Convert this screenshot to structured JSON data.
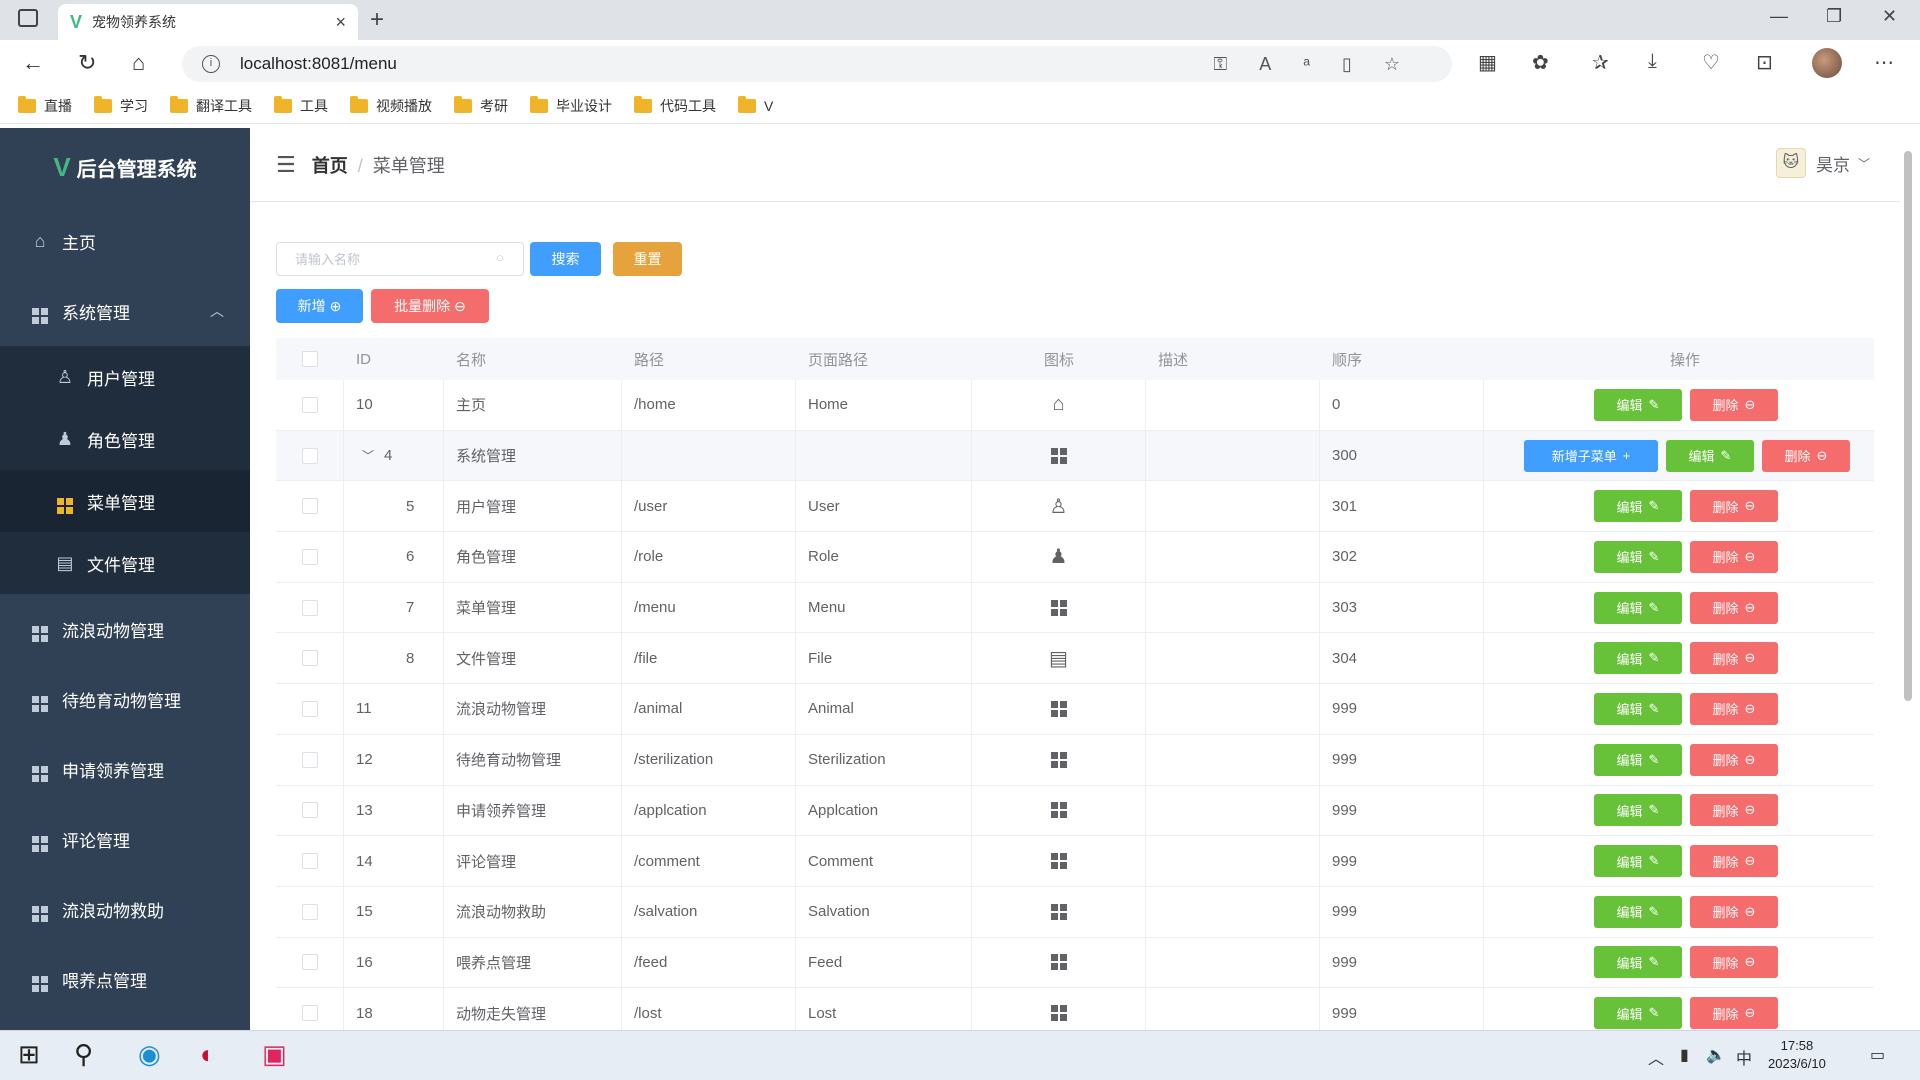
{
  "browser": {
    "tab_title": "宠物领养系统",
    "url": "localhost:8081/menu",
    "bookmarks": [
      "直播",
      "学习",
      "翻译工具",
      "工具",
      "视频播放",
      "考研",
      "毕业设计",
      "代码工具",
      "V"
    ]
  },
  "sidebar": {
    "logo": "后台管理系统",
    "items": [
      {
        "label": "主页",
        "icon": "home-icon"
      },
      {
        "label": "系统管理",
        "icon": "grid-icon"
      },
      {
        "label": "用户管理",
        "icon": "user-icon"
      },
      {
        "label": "角色管理",
        "icon": "user-filled-icon"
      },
      {
        "label": "菜单管理",
        "icon": "grid-icon"
      },
      {
        "label": "文件管理",
        "icon": "document-icon"
      },
      {
        "label": "流浪动物管理",
        "icon": "grid-icon"
      },
      {
        "label": "待绝育动物管理",
        "icon": "grid-icon"
      },
      {
        "label": "申请领养管理",
        "icon": "grid-icon"
      },
      {
        "label": "评论管理",
        "icon": "grid-icon"
      },
      {
        "label": "流浪动物救助",
        "icon": "grid-icon"
      },
      {
        "label": "喂养点管理",
        "icon": "grid-icon"
      }
    ]
  },
  "header": {
    "breadcrumb_home": "首页",
    "breadcrumb_sep": "/",
    "breadcrumb_current": "菜单管理",
    "username": "昊京"
  },
  "toolbar": {
    "search_placeholder": "请输入名称",
    "search_label": "搜索",
    "reset_label": "重置",
    "add_label": "新增",
    "batch_delete_label": "批量删除"
  },
  "table": {
    "columns": [
      "ID",
      "名称",
      "路径",
      "页面路径",
      "图标",
      "描述",
      "顺序",
      "操作"
    ],
    "edit_label": "编辑",
    "delete_label": "删除",
    "add_child_label": "新增子菜单",
    "rows": [
      {
        "id": "10",
        "name": "主页",
        "path": "/home",
        "page": "Home",
        "icon": "home-icon",
        "desc": "",
        "sort": "0"
      },
      {
        "id": "4",
        "name": "系统管理",
        "path": "",
        "page": "",
        "icon": "grid-icon",
        "desc": "",
        "sort": "300",
        "parent": true
      },
      {
        "id": "5",
        "name": "用户管理",
        "path": "/user",
        "page": "User",
        "icon": "user-icon",
        "desc": "",
        "sort": "301",
        "child": true
      },
      {
        "id": "6",
        "name": "角色管理",
        "path": "/role",
        "page": "Role",
        "icon": "user-filled-icon",
        "desc": "",
        "sort": "302",
        "child": true
      },
      {
        "id": "7",
        "name": "菜单管理",
        "path": "/menu",
        "page": "Menu",
        "icon": "grid-icon",
        "desc": "",
        "sort": "303",
        "child": true
      },
      {
        "id": "8",
        "name": "文件管理",
        "path": "/file",
        "page": "File",
        "icon": "document-icon",
        "desc": "",
        "sort": "304",
        "child": true
      },
      {
        "id": "11",
        "name": "流浪动物管理",
        "path": "/animal",
        "page": "Animal",
        "icon": "grid-icon",
        "desc": "",
        "sort": "999"
      },
      {
        "id": "12",
        "name": "待绝育动物管理",
        "path": "/sterilization",
        "page": "Sterilization",
        "icon": "grid-icon",
        "desc": "",
        "sort": "999"
      },
      {
        "id": "13",
        "name": "申请领养管理",
        "path": "/applcation",
        "page": "Applcation",
        "icon": "grid-icon",
        "desc": "",
        "sort": "999"
      },
      {
        "id": "14",
        "name": "评论管理",
        "path": "/comment",
        "page": "Comment",
        "icon": "grid-icon",
        "desc": "",
        "sort": "999"
      },
      {
        "id": "15",
        "name": "流浪动物救助",
        "path": "/salvation",
        "page": "Salvation",
        "icon": "grid-icon",
        "desc": "",
        "sort": "999"
      },
      {
        "id": "16",
        "name": "喂养点管理",
        "path": "/feed",
        "page": "Feed",
        "icon": "grid-icon",
        "desc": "",
        "sort": "999"
      },
      {
        "id": "18",
        "name": "动物走失管理",
        "path": "/lost",
        "page": "Lost",
        "icon": "grid-icon",
        "desc": "",
        "sort": "999"
      }
    ]
  },
  "taskbar": {
    "time": "17:58",
    "date": "2023/6/10",
    "ime": "中"
  },
  "colors": {
    "sidebar_bg": "#304156",
    "primary": "#409eff",
    "success": "#67c23a",
    "danger": "#f56c6c",
    "warning": "#e6a23c"
  }
}
